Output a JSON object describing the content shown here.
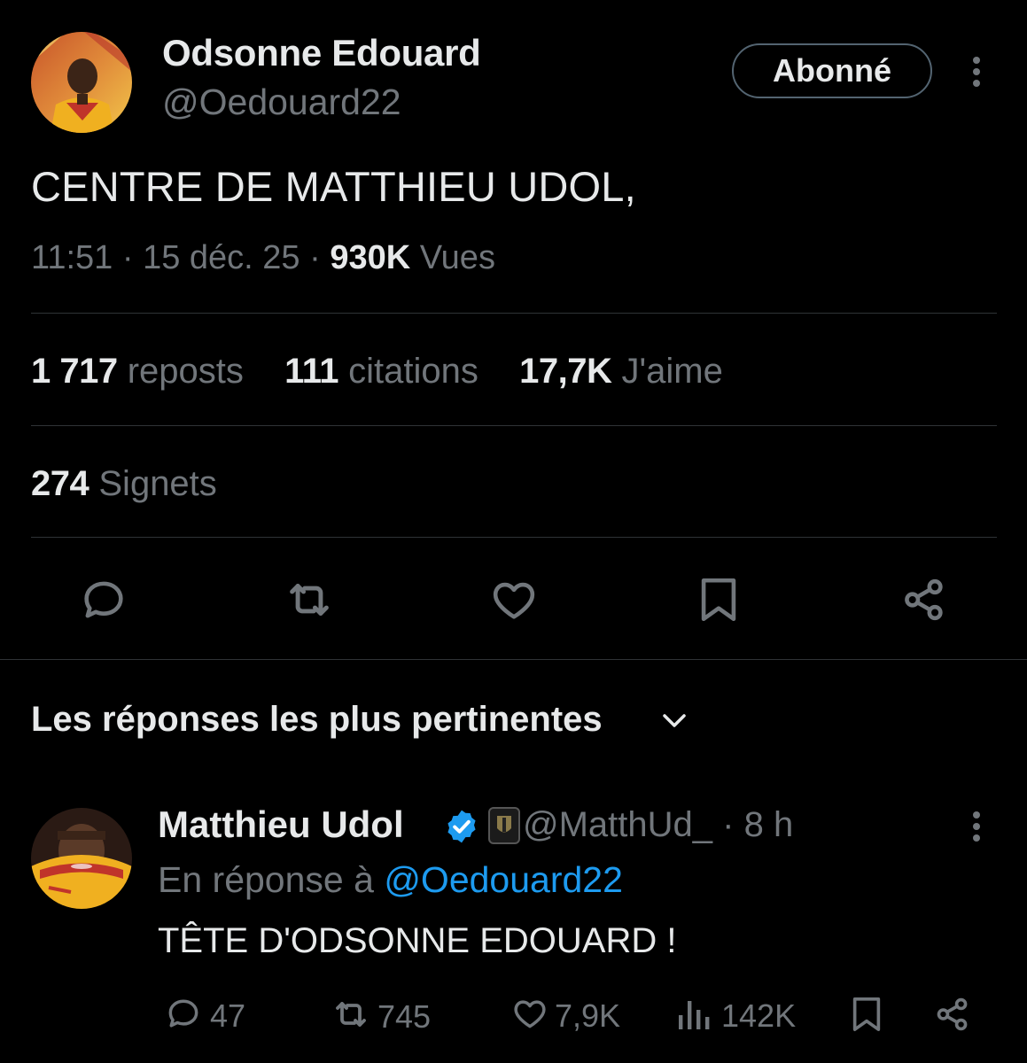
{
  "tweet": {
    "author_name": "Odsonne Edouard",
    "author_handle": "@Oedouard22",
    "follow_label": "Abonné",
    "text": "CENTRE DE MATTHIEU UDOL,",
    "time": "11:51",
    "sep": "·",
    "date": "15 déc. 25",
    "views_count": "930K",
    "views_label": "Vues",
    "stats": {
      "reposts_count": "1 717",
      "reposts_label": "reposts",
      "quotes_count": "111",
      "quotes_label": "citations",
      "likes_count": "17,7K",
      "likes_label": "J'aime",
      "bookmarks_count": "274",
      "bookmarks_label": "Signets"
    },
    "icons": [
      "reply-icon",
      "retweet-icon",
      "like-icon",
      "bookmark-icon",
      "share-icon"
    ]
  },
  "replies_section": {
    "title": "Les réponses les plus pertinentes"
  },
  "reply": {
    "author_name": "Matthieu Udol",
    "author_handle": "@MatthUd_",
    "sep": "·",
    "time_ago": "8 h",
    "in_reply_prefix": "En réponse à",
    "in_reply_handle": "@Oedouard22",
    "text": "TÊTE D'ODSONNE EDOUARD !",
    "reply_count": "47",
    "retweet_count": "745",
    "like_count": "7,9K",
    "views_count": "142K"
  },
  "colors": {
    "background": "#000000",
    "text": "#e7e9ea",
    "muted": "#71767b",
    "link": "#1d9bf0",
    "verified": "#1d9bf0",
    "divider": "#2f3336"
  }
}
